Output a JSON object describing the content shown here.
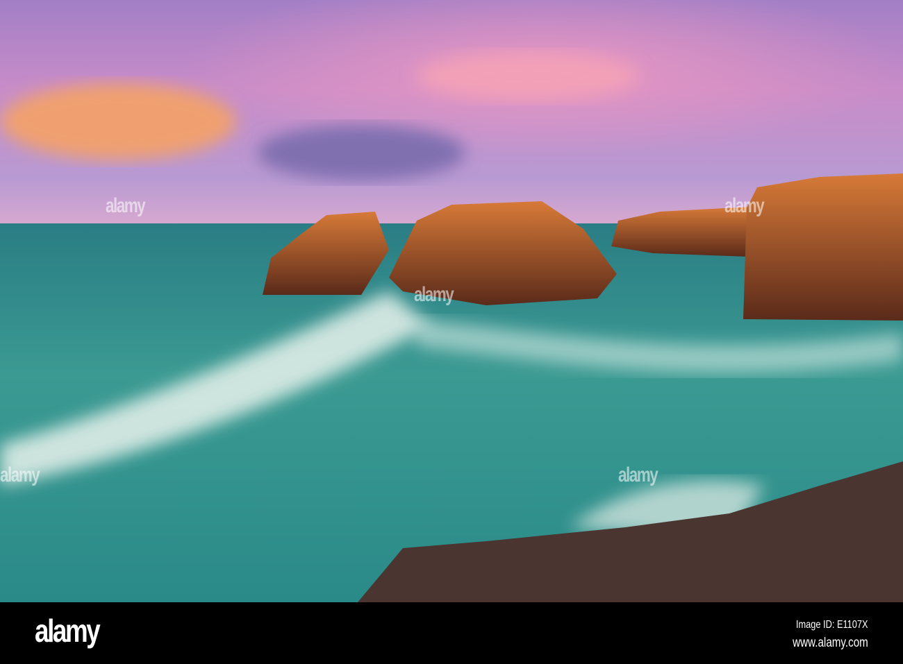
{
  "photo": {
    "subject": "coastal-rocks-waves-sunset",
    "watermark": "alamy"
  },
  "footer": {
    "logo": "alamy",
    "image_id": "Image ID: E1107X",
    "website": "www.alamy.com"
  },
  "colors": {
    "sky_pink": "#d98ac8",
    "sky_purple": "#9a86c8",
    "sea": "#2f8f8a",
    "rock": "#b4552a"
  }
}
